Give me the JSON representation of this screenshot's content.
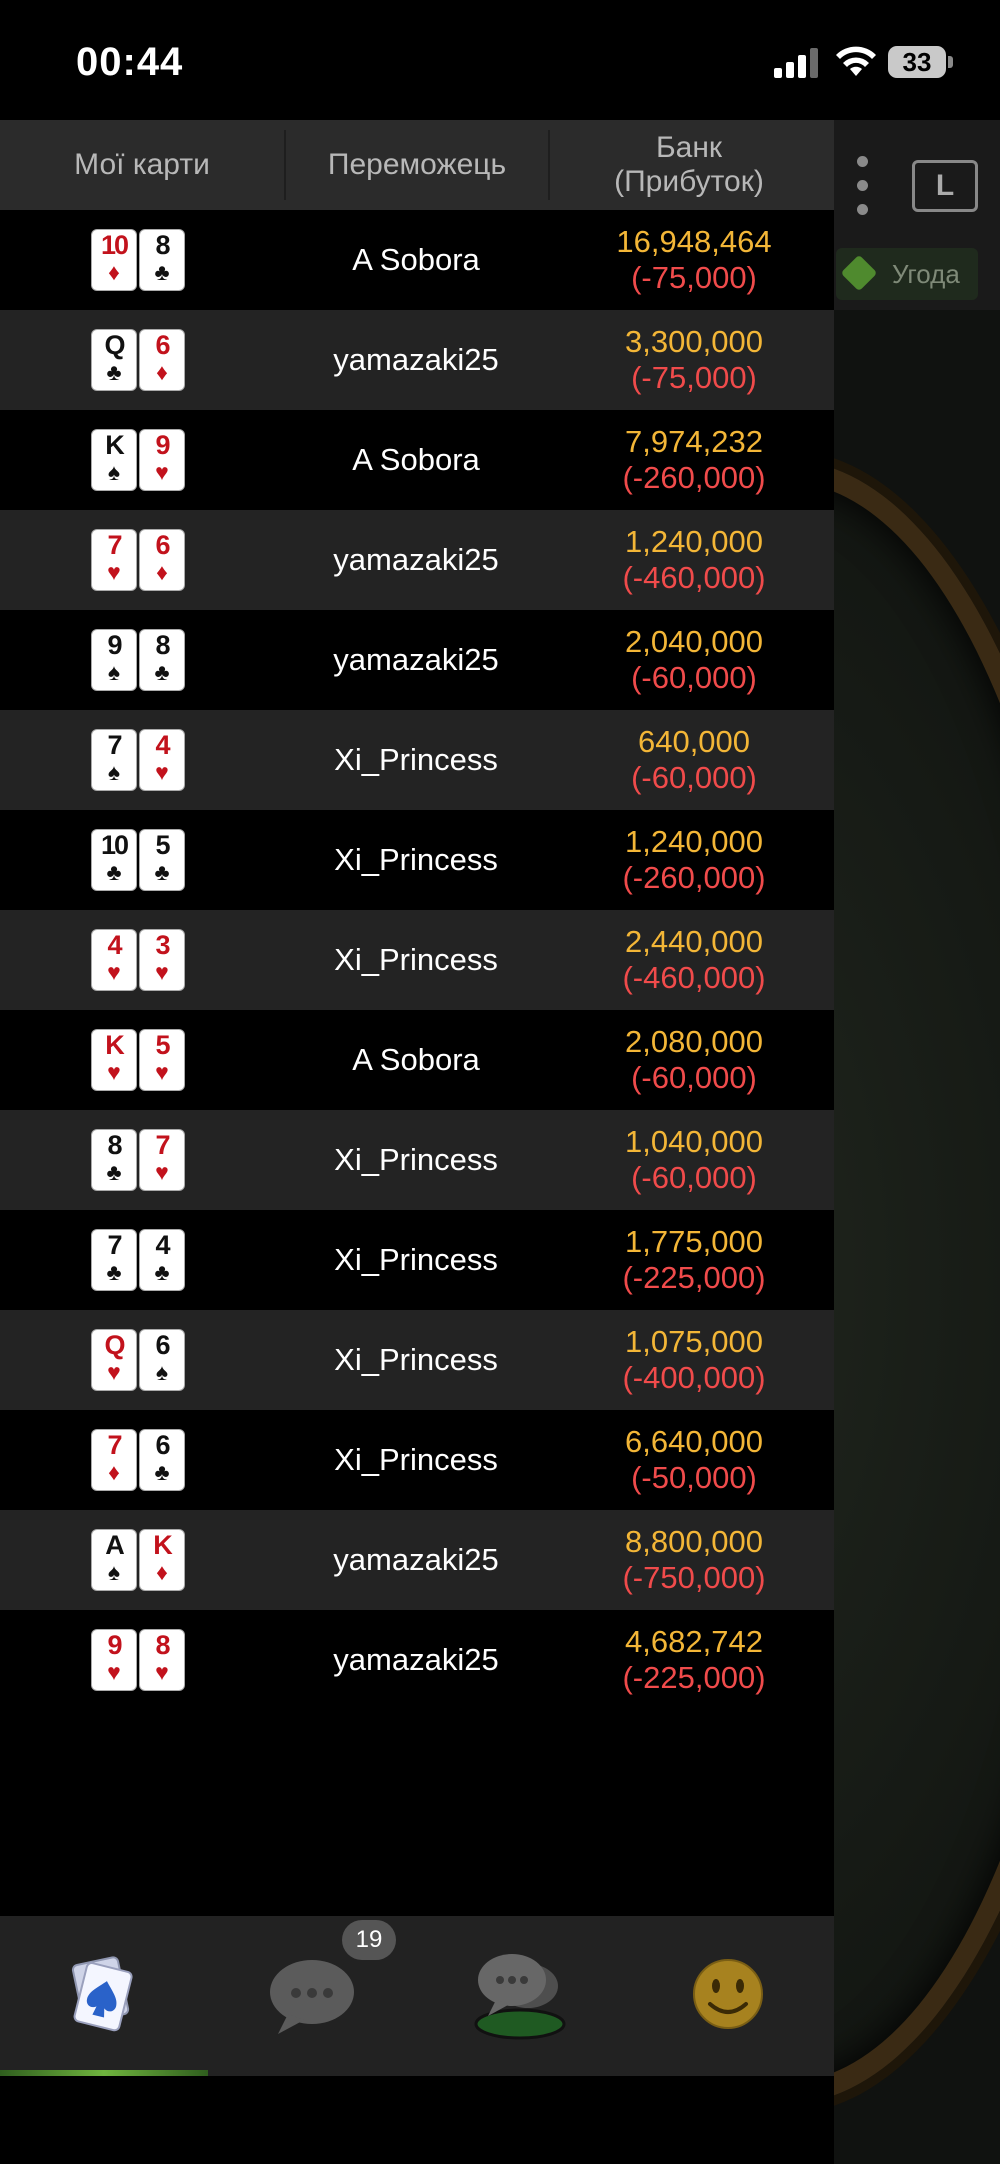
{
  "status": {
    "time": "00:44",
    "battery": "33"
  },
  "side": {
    "deal_label": "Угода"
  },
  "header": {
    "my_cards": "Мої карти",
    "winner": "Переможець",
    "bank": "Банк",
    "profit": "(Прибуток)"
  },
  "rows": [
    {
      "c1": {
        "rank": "10",
        "suit": "♦",
        "color": "red"
      },
      "c2": {
        "rank": "8",
        "suit": "♣",
        "color": "black"
      },
      "winner": "A Sobora",
      "bank": "16,948,464",
      "profit": "(-75,000)"
    },
    {
      "c1": {
        "rank": "Q",
        "suit": "♣",
        "color": "black"
      },
      "c2": {
        "rank": "6",
        "suit": "♦",
        "color": "red"
      },
      "winner": "yamazaki25",
      "bank": "3,300,000",
      "profit": "(-75,000)"
    },
    {
      "c1": {
        "rank": "K",
        "suit": "♠",
        "color": "black"
      },
      "c2": {
        "rank": "9",
        "suit": "♥",
        "color": "red"
      },
      "winner": "A Sobora",
      "bank": "7,974,232",
      "profit": "(-260,000)"
    },
    {
      "c1": {
        "rank": "7",
        "suit": "♥",
        "color": "red"
      },
      "c2": {
        "rank": "6",
        "suit": "♦",
        "color": "red"
      },
      "winner": "yamazaki25",
      "bank": "1,240,000",
      "profit": "(-460,000)"
    },
    {
      "c1": {
        "rank": "9",
        "suit": "♠",
        "color": "black"
      },
      "c2": {
        "rank": "8",
        "suit": "♣",
        "color": "black"
      },
      "winner": "yamazaki25",
      "bank": "2,040,000",
      "profit": "(-60,000)"
    },
    {
      "c1": {
        "rank": "7",
        "suit": "♠",
        "color": "black"
      },
      "c2": {
        "rank": "4",
        "suit": "♥",
        "color": "red"
      },
      "winner": "Xi_Princess",
      "bank": "640,000",
      "profit": "(-60,000)"
    },
    {
      "c1": {
        "rank": "10",
        "suit": "♣",
        "color": "black"
      },
      "c2": {
        "rank": "5",
        "suit": "♣",
        "color": "black"
      },
      "winner": "Xi_Princess",
      "bank": "1,240,000",
      "profit": "(-260,000)"
    },
    {
      "c1": {
        "rank": "4",
        "suit": "♥",
        "color": "red"
      },
      "c2": {
        "rank": "3",
        "suit": "♥",
        "color": "red"
      },
      "winner": "Xi_Princess",
      "bank": "2,440,000",
      "profit": "(-460,000)"
    },
    {
      "c1": {
        "rank": "K",
        "suit": "♥",
        "color": "red"
      },
      "c2": {
        "rank": "5",
        "suit": "♥",
        "color": "red"
      },
      "winner": "A Sobora",
      "bank": "2,080,000",
      "profit": "(-60,000)"
    },
    {
      "c1": {
        "rank": "8",
        "suit": "♣",
        "color": "black"
      },
      "c2": {
        "rank": "7",
        "suit": "♥",
        "color": "red"
      },
      "winner": "Xi_Princess",
      "bank": "1,040,000",
      "profit": "(-60,000)"
    },
    {
      "c1": {
        "rank": "7",
        "suit": "♣",
        "color": "black"
      },
      "c2": {
        "rank": "4",
        "suit": "♣",
        "color": "black"
      },
      "winner": "Xi_Princess",
      "bank": "1,775,000",
      "profit": "(-225,000)"
    },
    {
      "c1": {
        "rank": "Q",
        "suit": "♥",
        "color": "red"
      },
      "c2": {
        "rank": "6",
        "suit": "♠",
        "color": "black"
      },
      "winner": "Xi_Princess",
      "bank": "1,075,000",
      "profit": "(-400,000)"
    },
    {
      "c1": {
        "rank": "7",
        "suit": "♦",
        "color": "red"
      },
      "c2": {
        "rank": "6",
        "suit": "♣",
        "color": "black"
      },
      "winner": "Xi_Princess",
      "bank": "6,640,000",
      "profit": "(-50,000)"
    },
    {
      "c1": {
        "rank": "A",
        "suit": "♠",
        "color": "black"
      },
      "c2": {
        "rank": "K",
        "suit": "♦",
        "color": "red"
      },
      "winner": "yamazaki25",
      "bank": "8,800,000",
      "profit": "(-750,000)"
    },
    {
      "c1": {
        "rank": "9",
        "suit": "♥",
        "color": "red"
      },
      "c2": {
        "rank": "8",
        "suit": "♥",
        "color": "red"
      },
      "winner": "yamazaki25",
      "bank": "4,682,742",
      "profit": "(-225,000)"
    }
  ],
  "tabbar": {
    "tabs": [
      {
        "name": "hand-history",
        "icon": "cards-icon",
        "active": true
      },
      {
        "name": "chat",
        "icon": "chat-bubble-icon",
        "badge": "19"
      },
      {
        "name": "table-chat",
        "icon": "table-chat-icon"
      },
      {
        "name": "emoji",
        "icon": "smiley-icon"
      }
    ]
  },
  "colors": {
    "bank": "#f3b637",
    "profit": "#f04b4b",
    "card_red": "#c2121c",
    "active_tab": "#6fb43e"
  }
}
